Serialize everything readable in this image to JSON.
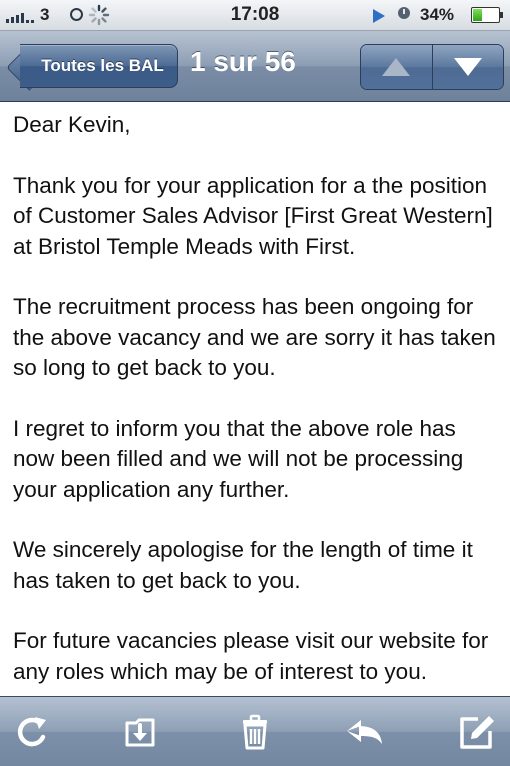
{
  "status_bar": {
    "carrier": "3",
    "time": "17:08",
    "battery": "34%",
    "battery_level": 0.34,
    "icons": [
      "signal-icon",
      "3g-icon",
      "activity-spinner-icon",
      "play-icon",
      "alarm-clock-icon",
      "battery-icon"
    ]
  },
  "nav": {
    "back_label": "Toutes les BAL",
    "title": "1 sur 56",
    "prev_icon": "arrow-up-icon",
    "next_icon": "arrow-down-icon"
  },
  "message": {
    "greeting": "Dear Kevin,",
    "paragraphs": [
      "Thank you for your application for a the position of Customer Sales Advisor [First Great Western] at Bristol Temple Meads with First.",
      "The recruitment process has been ongoing for the above vacancy and we are sorry it has taken so long to get back to you.",
      "I regret to inform you that the above role has now been filled and we will not be processing your application any further.",
      "We sincerely apologise for the length of time it has taken to get back to you.",
      "For future vacancies please visit our website for any roles which may be of interest to you."
    ]
  },
  "toolbar": {
    "icons": [
      "refresh-icon",
      "move-to-folder-icon",
      "trash-icon",
      "reply-icon",
      "compose-icon"
    ]
  },
  "colors": {
    "bar_blue": "#7a8ca6",
    "button_blue": "#3d5d8a",
    "battery_green": "#2fa31a"
  }
}
